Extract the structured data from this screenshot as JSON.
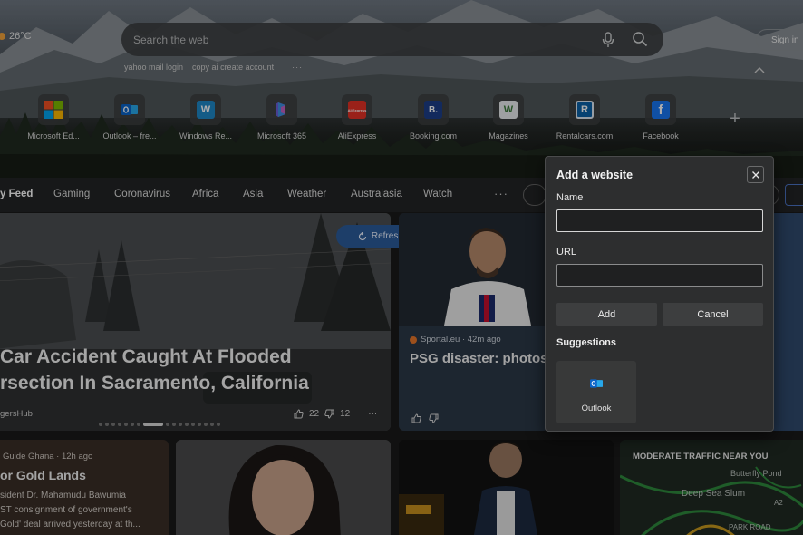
{
  "weather": {
    "temp": "26°C"
  },
  "header": {
    "signin_label": "Sign in"
  },
  "search": {
    "placeholder": "Search the web"
  },
  "recent_searches": [
    "yahoo mail login",
    "copy ai create account"
  ],
  "recent_more": "···",
  "quick_links": [
    {
      "label": "Microsoft Ed...",
      "icon": "microsoft-logo-icon",
      "color": "#f25022"
    },
    {
      "label": "Outlook – fre...",
      "icon": "outlook-icon",
      "color": "#0a64c9"
    },
    {
      "label": "Windows Re...",
      "icon": "windows-report-icon",
      "color": "#1e88c8",
      "glyph": "W"
    },
    {
      "label": "Microsoft 365",
      "icon": "microsoft-365-icon",
      "color": "#6b5ed7"
    },
    {
      "label": "AliExpress",
      "icon": "aliexpress-icon",
      "color": "#e43225",
      "glyph": "AliExpress"
    },
    {
      "label": "Booking.com",
      "icon": "booking-icon",
      "color": "#1d3f8a",
      "glyph": "B."
    },
    {
      "label": "Magazines",
      "icon": "magazines-icon",
      "color": "#3a7a3a",
      "glyph": "W"
    },
    {
      "label": "Rentalcars.com",
      "icon": "rentalcars-icon",
      "color": "#0b62a8",
      "glyph": "R"
    },
    {
      "label": "Facebook",
      "icon": "facebook-icon",
      "color": "#1877f2",
      "glyph": "f"
    }
  ],
  "nav": {
    "items": [
      "y Feed",
      "Gaming",
      "Coronavirus",
      "Africa",
      "Asia",
      "Weather",
      "Australasia",
      "Watch"
    ],
    "more": "···"
  },
  "feed": {
    "refresh_label": "Refresh stories",
    "main": {
      "headline_1": "Car Accident Caught At Flooded",
      "headline_2": "rsection In Sacramento, California",
      "source": "gersHub",
      "likes": "22",
      "dislikes": "12",
      "more": "···"
    },
    "messi": {
      "source": "Sportal.eu · 42m ago",
      "title": "PSG disaster: photos"
    },
    "ghana": {
      "source": "Guide Ghana · 12h ago",
      "title": "or Gold Lands",
      "lines": [
        "sident Dr. Mahamudu Bawumia",
        "ST consignment of government's",
        "Gold' deal arrived yesterday at th..."
      ]
    },
    "traffic": {
      "title": "MODERATE TRAFFIC NEAR YOU",
      "labels": [
        "Butterfly Pond",
        "Deep Sea Slum",
        "PARK ROAD",
        "A2"
      ]
    }
  },
  "dialog": {
    "title": "Add a website",
    "name_label": "Name",
    "name_value": "",
    "url_label": "URL",
    "url_value": "",
    "add_label": "Add",
    "cancel_label": "Cancel",
    "suggestions_label": "Suggestions",
    "suggestions": [
      {
        "name": "Outlook",
        "icon": "outlook-icon"
      }
    ]
  }
}
